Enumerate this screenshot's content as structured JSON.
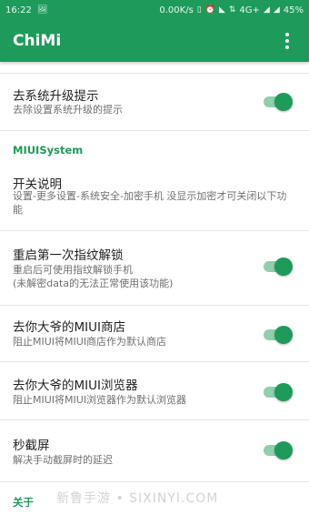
{
  "status_bar": {
    "time": "16:22",
    "net_speed": "0.00K/s",
    "network": "4G+",
    "battery": "45%"
  },
  "app_bar": {
    "title": "ChiMi"
  },
  "items": [
    {
      "title": "去系统升级提示",
      "subtitle": "去除设置系统升级的提示",
      "toggle": true
    },
    {
      "title": "开关说明",
      "subtitle": "设置-更多设置-系统安全-加密手机 没显示加密才可关闭以下功能",
      "toggle": false
    },
    {
      "title": "重启第一次指纹解锁",
      "subtitle": "重启后可使用指纹解锁手机\n(未解密data的无法正常使用该功能)",
      "toggle": true
    },
    {
      "title": "去你大爷的MIUI商店",
      "subtitle": "阻止MIUI将MIUI商店作为默认商店",
      "toggle": true
    },
    {
      "title": "去你大爷的MIUI浏览器",
      "subtitle": "阻止MIUI将MIUI浏览器作为默认浏览器",
      "toggle": true
    },
    {
      "title": "秒截屏",
      "subtitle": "解决手动截屏时的延迟",
      "toggle": true
    }
  ],
  "sections": {
    "miui_system": "MIUISystem",
    "about": "关于"
  },
  "watermark": "新鲁手游 • SIXINYI.COM",
  "colors": {
    "primary": "#1e9a5b",
    "toggle_track": "#8fcfab"
  }
}
